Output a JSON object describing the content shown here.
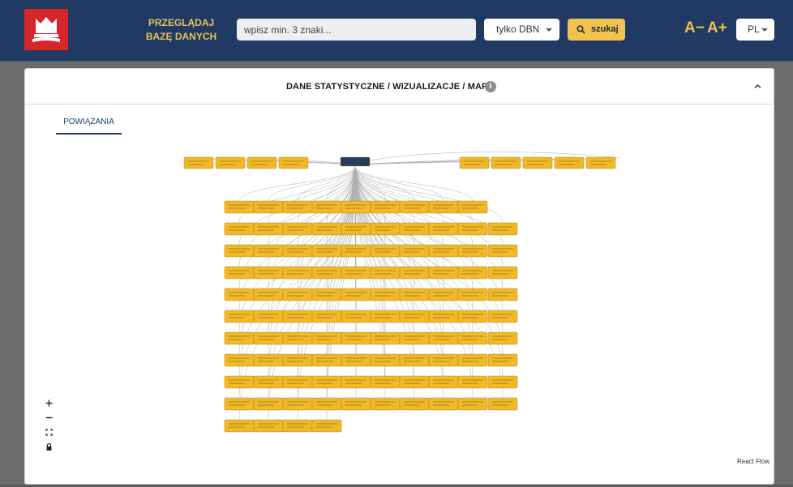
{
  "header": {
    "browse_label": "PRZEGLĄDAJ BAZĘ DANYCH",
    "search_placeholder": "wpisz min. 3 znaki...",
    "filter_selected": "tylko DBN",
    "search_button": "szukaj",
    "font_decrease": "A−",
    "font_increase": "A+",
    "language": "PL"
  },
  "panel": {
    "title": "DANE STATYSTYCZNE / WIZUALIZACJE / MAPY",
    "info_glyph": "i"
  },
  "tabs": [
    {
      "label": "POWIĄZANIA",
      "active": true
    }
  ],
  "flow": {
    "controls": [
      "zoom-in",
      "zoom-out",
      "fit-view",
      "lock"
    ],
    "attribution": "React Flow",
    "node_color": "#f2b927",
    "root_color": "#213a63",
    "edge_color": "#b0b0b0",
    "node_count": 112
  },
  "colors": {
    "header_bg": "#213a63",
    "accent": "#f2c24f",
    "logo_bg": "#d6262b"
  }
}
